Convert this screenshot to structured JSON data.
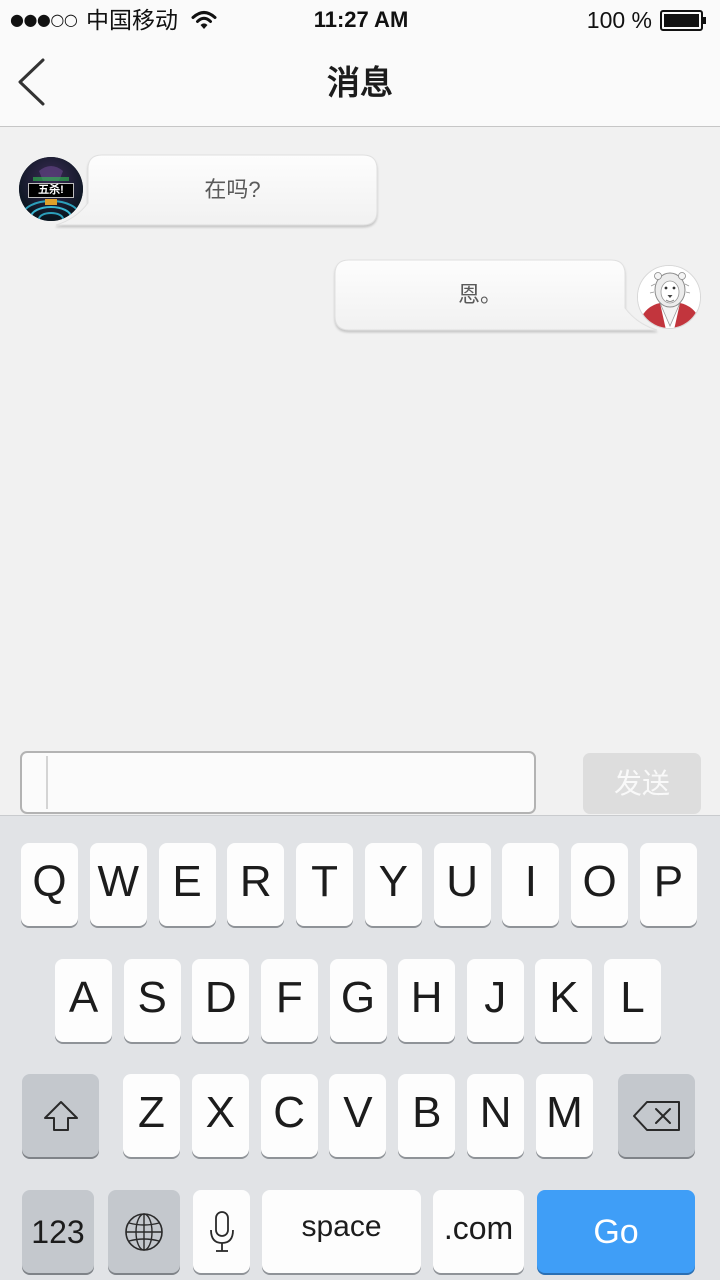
{
  "status_bar": {
    "signal": "●●●○○",
    "carrier": "中国移动",
    "wifi_icon": "wifi-icon",
    "time": "11:27 AM",
    "battery": "100 %",
    "battery_icon": "battery-icon"
  },
  "nav": {
    "back_icon": "chevron-left-icon",
    "title": "消息"
  },
  "messages": [
    {
      "sent": false,
      "text": "在吗?",
      "avatar_icon": "game-avatar-icon",
      "avatar_label": "五杀!"
    },
    {
      "sent": true,
      "text": "恩。",
      "avatar_icon": "lion-avatar-icon"
    }
  ],
  "composer": {
    "input_value": "",
    "send_label": "发送"
  },
  "keyboard": {
    "row1": [
      "Q",
      "W",
      "E",
      "R",
      "T",
      "Y",
      "U",
      "I",
      "O",
      "P"
    ],
    "row2": [
      "A",
      "S",
      "D",
      "F",
      "G",
      "H",
      "J",
      "K",
      "L"
    ],
    "row3": [
      "Z",
      "X",
      "C",
      "V",
      "B",
      "N",
      "M"
    ],
    "shift_icon": "shift-icon",
    "delete_icon": "backspace-icon",
    "numbers_label": "123",
    "globe_icon": "globe-icon",
    "mic_icon": "microphone-icon",
    "space_label": "space",
    "dotcom_label": ".com",
    "go_label": "Go"
  },
  "colors": {
    "chat_background": "#f1f1f1",
    "nav_background": "#fafafa",
    "keyboard_background": "#e1e3e6",
    "special_key": "#c4c8cd",
    "go_key": "#3f9ef7",
    "send_button": "#dddddd"
  }
}
